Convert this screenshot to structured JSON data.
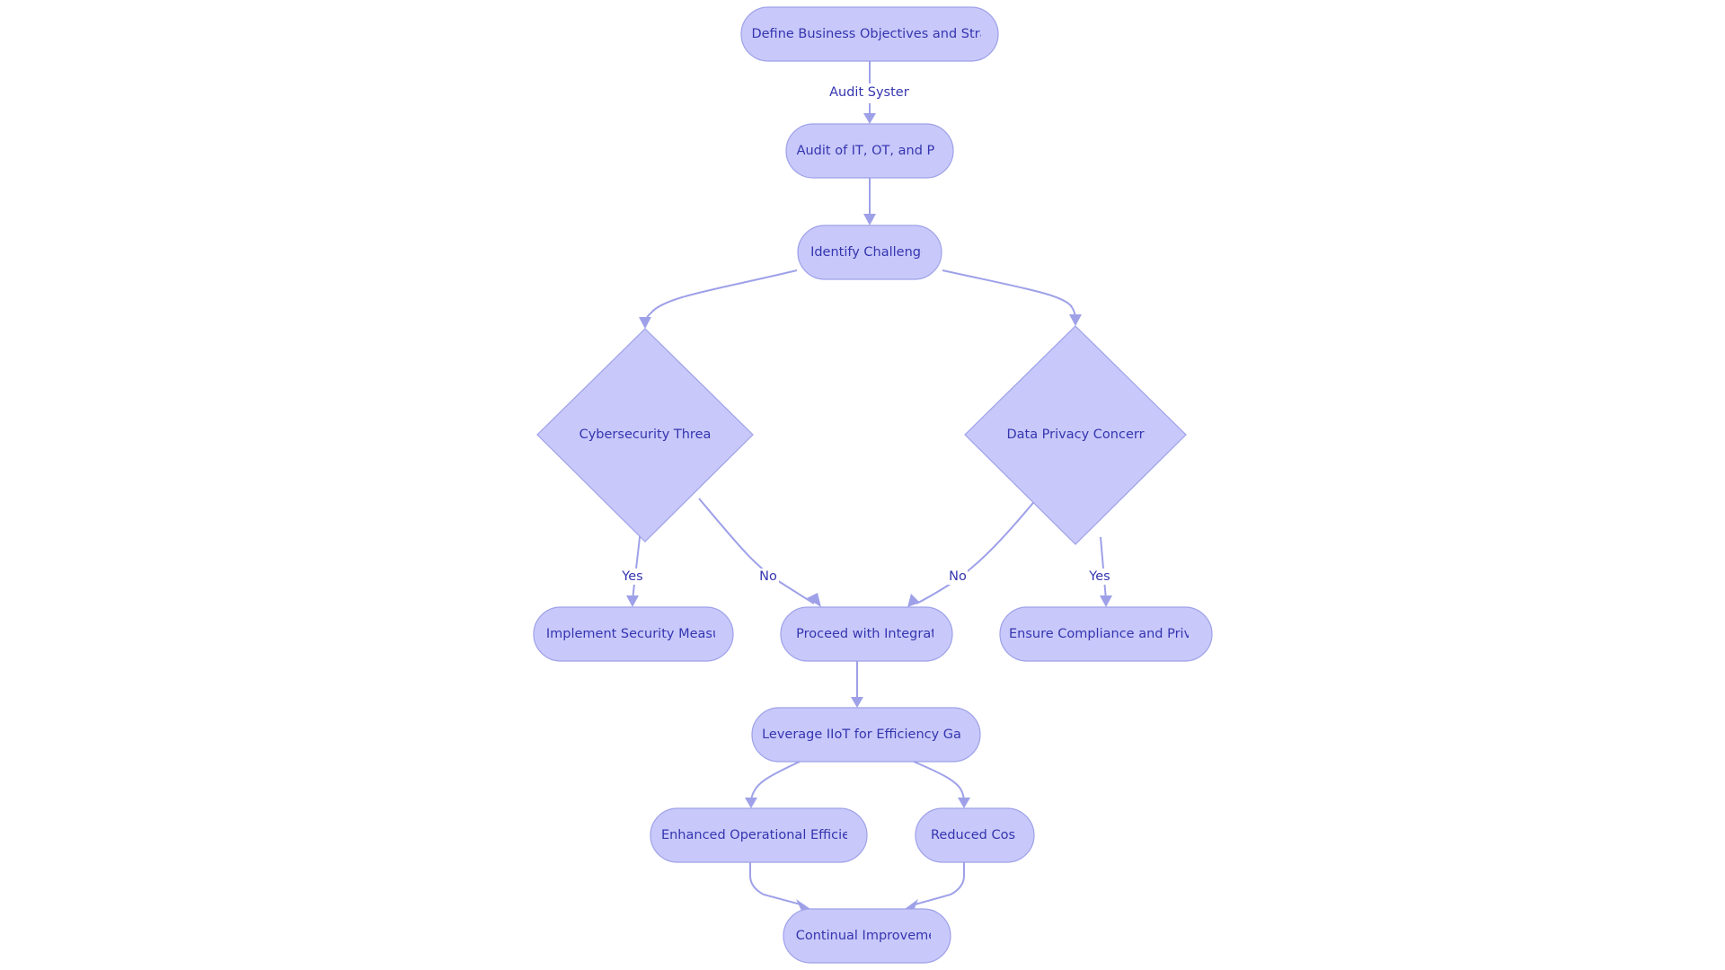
{
  "diagram": {
    "type": "flowchart",
    "colors": {
      "node_fill": "#c8c9fa",
      "node_stroke": "#9ea1e8",
      "text": "#3535b0",
      "edge": "#9ea1e8"
    },
    "nodes": {
      "define": {
        "label": "Define Business Objectives and Stra",
        "shape": "rounded"
      },
      "audit": {
        "label": "Audit of IT, OT, and PE",
        "shape": "rounded"
      },
      "identify": {
        "label": "Identify Challenge",
        "shape": "rounded"
      },
      "cyber": {
        "label": "Cybersecurity Threa",
        "shape": "diamond"
      },
      "privacy": {
        "label": "Data Privacy Concerr",
        "shape": "diamond"
      },
      "implement": {
        "label": "Implement Security Measu",
        "shape": "rounded"
      },
      "proceed": {
        "label": "Proceed with Integrat",
        "shape": "rounded"
      },
      "ensure": {
        "label": "Ensure Compliance and Priva",
        "shape": "rounded"
      },
      "leverage": {
        "label": "Leverage IIoT for Efficiency Gair",
        "shape": "rounded"
      },
      "enhanced": {
        "label": "Enhanced Operational Efficier",
        "shape": "rounded"
      },
      "reduced": {
        "label": "Reduced Cos",
        "shape": "rounded"
      },
      "continual": {
        "label": "Continual Improveme",
        "shape": "rounded"
      }
    },
    "edges": [
      {
        "from": "define",
        "to": "audit",
        "label": "Audit Systen"
      },
      {
        "from": "audit",
        "to": "identify",
        "label": ""
      },
      {
        "from": "identify",
        "to": "cyber",
        "label": ""
      },
      {
        "from": "identify",
        "to": "privacy",
        "label": ""
      },
      {
        "from": "cyber",
        "to": "implement",
        "label": "Yes"
      },
      {
        "from": "cyber",
        "to": "proceed",
        "label": "No"
      },
      {
        "from": "privacy",
        "to": "proceed",
        "label": "No"
      },
      {
        "from": "privacy",
        "to": "ensure",
        "label": "Yes"
      },
      {
        "from": "proceed",
        "to": "leverage",
        "label": ""
      },
      {
        "from": "leverage",
        "to": "enhanced",
        "label": ""
      },
      {
        "from": "leverage",
        "to": "reduced",
        "label": ""
      },
      {
        "from": "enhanced",
        "to": "continual",
        "label": ""
      },
      {
        "from": "reduced",
        "to": "continual",
        "label": ""
      }
    ]
  }
}
